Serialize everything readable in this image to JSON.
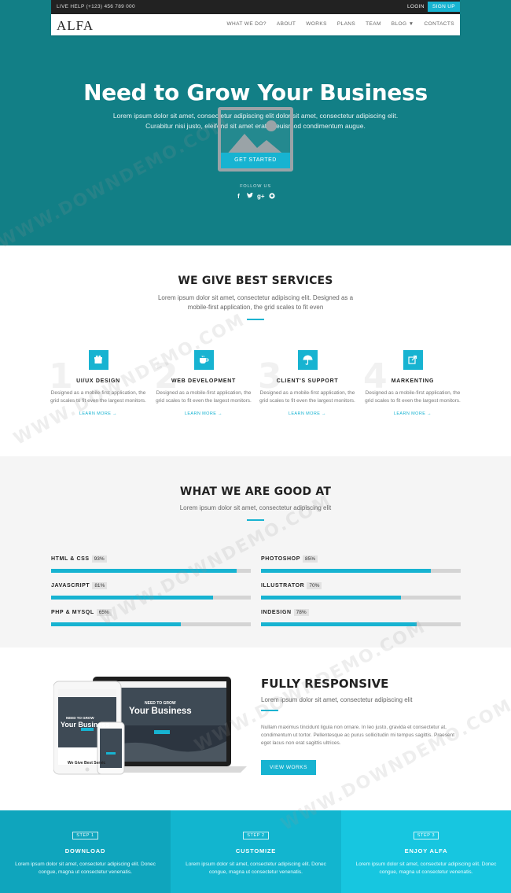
{
  "topbar": {
    "help": "LIVE HELP (+123) 456 789 000",
    "login": "LOGIN",
    "signup": "SIGN UP"
  },
  "header": {
    "logo": "ALFA",
    "nav": [
      "WHAT WE DO?",
      "ABOUT",
      "WORKS",
      "PLANS",
      "TEAM",
      "BLOG",
      "CONTACTS"
    ]
  },
  "hero": {
    "title": "Need to Grow Your Business",
    "lead1": "Lorem ipsum dolor sit amet, consectetur adipiscing elit dolor sit amet, consectetur adipiscing elit.",
    "lead2": "Curabitur nisi justo, eleifend sit amet erat a, euismod condimentum augue.",
    "cta": "GET STARTED",
    "follow": "FOLLOW US",
    "social": [
      "f",
      "t",
      "g+",
      "gh"
    ]
  },
  "services": {
    "title": "WE GIVE BEST SERVICES",
    "sub1": "Lorem ipsum dolor sit amet, consectetur adipiscing elit. Designed as a",
    "sub2": "mobile-first application, the grid scales to fit even",
    "items": [
      {
        "num": "1",
        "title": "UI/UX DESIGN",
        "text": "Designed as a mobile-first application, the grid scales to fit even the largest monitors.",
        "link": "LEARN MORE →",
        "icon": "gift-icon"
      },
      {
        "num": "2",
        "title": "WEB DEVELOPMENT",
        "text": "Designed as a mobile-first application, the grid scales to fit even the largest monitors.",
        "link": "LEARN MORE →",
        "icon": "coffee-icon"
      },
      {
        "num": "3",
        "title": "CLIENT'S SUPPORT",
        "text": "Designed as a mobile-first application, the grid scales to fit even the largest monitors.",
        "link": "LEARN MORE →",
        "icon": "umbrella-icon"
      },
      {
        "num": "4",
        "title": "MARKENTING",
        "text": "Designed as a mobile-first application, the grid scales to fit even the largest monitors.",
        "link": "LEARN MORE →",
        "icon": "share-icon"
      }
    ]
  },
  "skills": {
    "title": "WHAT WE ARE GOOD AT",
    "sub": "Lorem ipsum dolor sit amet, consectetur adipiscing elit",
    "items": [
      {
        "label": "HTML & CSS",
        "pct": "93%",
        "value": 93
      },
      {
        "label": "PHOTOSHOP",
        "pct": "85%",
        "value": 85
      },
      {
        "label": "JAVASCRIPT",
        "pct": "81%",
        "value": 81
      },
      {
        "label": "ILLUSTRATOR",
        "pct": "70%",
        "value": 70
      },
      {
        "label": "PHP & MYSQL",
        "pct": "65%",
        "value": 65
      },
      {
        "label": "INDESIGN",
        "pct": "78%",
        "value": 78
      }
    ]
  },
  "responsive": {
    "title": "FULLY RESPONSIVE",
    "sub": "Lorem ipsum dolor sit amet, consectetur adipiscing elit",
    "body": "Nullam maximus tincidunt ligula non ornare. In leo justo, gravida et consectetur at, condimentum ut tortor. Pellentesque ac purus sollicitudin mi tempus sagittis. Praesent eget lacus non erat sagittis ultrices.",
    "button": "VIEW WORKS",
    "mock_small": "NEED TO GROW",
    "mock_big": "Your Business",
    "mock_footer": "We Give Best Servic"
  },
  "steps": [
    {
      "badge": "STEP 1",
      "title": "DOWNLOAD",
      "text": "Lorem ipsum dolor sit amet, consectetur adipiscing elit. Donec congue, magna ut consectetur venenatis.",
      "color": "#0fa5bd"
    },
    {
      "badge": "STEP 2",
      "title": "CUSTOMIZE",
      "text": "Lorem ipsum dolor sit amet, consectetur adipiscing elit. Donec congue, magna ut consectetur venenatis.",
      "color": "#12b5cf"
    },
    {
      "badge": "STEP 3",
      "title": "ENJOY ALFA",
      "text": "Lorem ipsum dolor sit amet, consectetur adipiscing elit. Donec congue, magna ut consectetur venenatis.",
      "color": "#17c6e0"
    }
  ],
  "watermark": "WWW.DOWNDEMO.COM"
}
